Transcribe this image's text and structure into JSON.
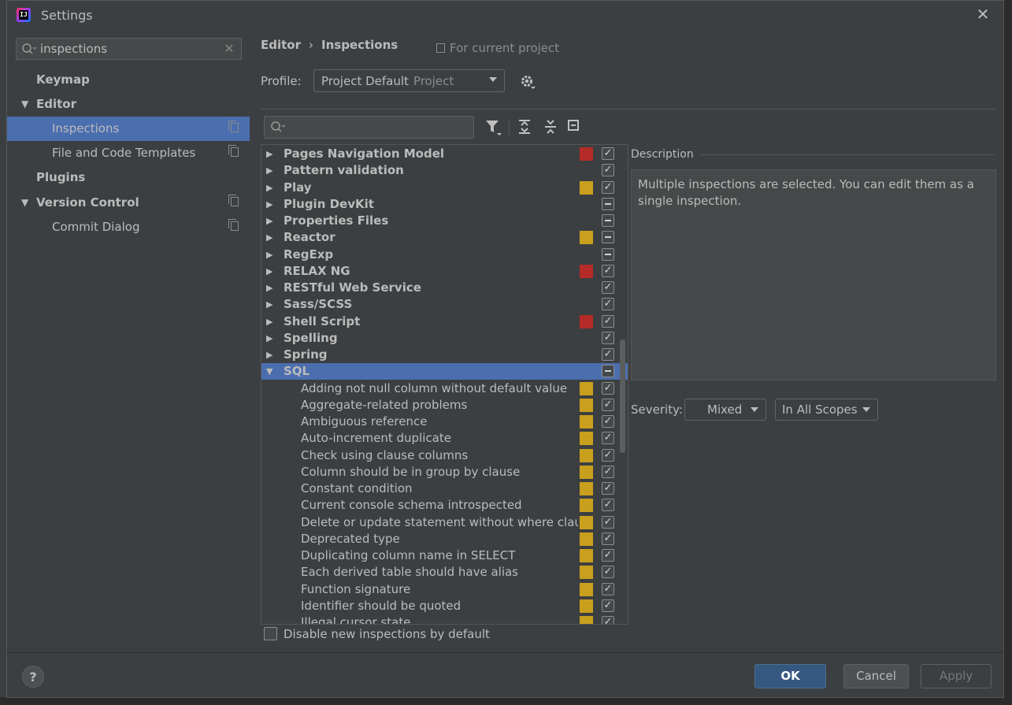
{
  "window": {
    "title": "Settings",
    "close_glyph": "✕"
  },
  "search": {
    "value": "inspections"
  },
  "nav": {
    "items": [
      {
        "label": "Keymap",
        "level": 0,
        "bold": true
      },
      {
        "label": "Editor",
        "level": 0,
        "bold": true,
        "expanded": true
      },
      {
        "label": "Inspections",
        "level": 1,
        "selected": true,
        "project_icon": true
      },
      {
        "label": "File and Code Templates",
        "level": 1,
        "project_icon": true
      },
      {
        "label": "Plugins",
        "level": 0,
        "bold": true
      },
      {
        "label": "Version Control",
        "level": 0,
        "bold": true,
        "expanded": true,
        "project_icon": true
      },
      {
        "label": "Commit Dialog",
        "level": 1,
        "project_icon": true
      }
    ]
  },
  "breadcrumb": {
    "part1": "Editor",
    "separator": "›",
    "part2": "Inspections"
  },
  "scope_note": "For current project",
  "profile": {
    "label": "Profile:",
    "value": "Project Default",
    "sub": "Project"
  },
  "colors": {
    "error": "#b52b27",
    "warning": "#c9a01e",
    "selection": "#4b6eaf"
  },
  "inspections": [
    {
      "name": "Pages Navigation Model",
      "group": true,
      "severity": "error",
      "state": "checked"
    },
    {
      "name": "Pattern validation",
      "group": true,
      "severity": "",
      "state": "checked"
    },
    {
      "name": "Play",
      "group": true,
      "severity": "warning",
      "state": "checked"
    },
    {
      "name": "Plugin DevKit",
      "group": true,
      "severity": "",
      "state": "mixed"
    },
    {
      "name": "Properties Files",
      "group": true,
      "severity": "",
      "state": "mixed"
    },
    {
      "name": "Reactor",
      "group": true,
      "severity": "warning",
      "state": "mixed"
    },
    {
      "name": "RegExp",
      "group": true,
      "severity": "",
      "state": "mixed"
    },
    {
      "name": "RELAX NG",
      "group": true,
      "severity": "error",
      "state": "checked"
    },
    {
      "name": "RESTful Web Service",
      "group": true,
      "severity": "",
      "state": "checked"
    },
    {
      "name": "Sass/SCSS",
      "group": true,
      "severity": "",
      "state": "checked"
    },
    {
      "name": "Shell Script",
      "group": true,
      "severity": "error",
      "state": "checked"
    },
    {
      "name": "Spelling",
      "group": true,
      "severity": "",
      "state": "checked"
    },
    {
      "name": "Spring",
      "group": true,
      "severity": "",
      "state": "checked"
    },
    {
      "name": "SQL",
      "group": true,
      "expanded": true,
      "selected": true,
      "severity": "",
      "state": "mixed"
    },
    {
      "name": "Adding not null column without default value",
      "group": false,
      "severity": "warning",
      "state": "checked"
    },
    {
      "name": "Aggregate-related problems",
      "group": false,
      "severity": "warning",
      "state": "checked"
    },
    {
      "name": "Ambiguous reference",
      "group": false,
      "severity": "warning",
      "state": "checked"
    },
    {
      "name": "Auto-increment duplicate",
      "group": false,
      "severity": "warning",
      "state": "checked"
    },
    {
      "name": "Check using clause columns",
      "group": false,
      "severity": "warning",
      "state": "checked"
    },
    {
      "name": "Column should be in group by clause",
      "group": false,
      "severity": "warning",
      "state": "checked"
    },
    {
      "name": "Constant condition",
      "group": false,
      "severity": "warning",
      "state": "checked"
    },
    {
      "name": "Current console schema introspected",
      "group": false,
      "severity": "warning",
      "state": "checked"
    },
    {
      "name": "Delete or update statement without where claus",
      "group": false,
      "severity": "warning",
      "state": "checked"
    },
    {
      "name": "Deprecated type",
      "group": false,
      "severity": "warning",
      "state": "checked"
    },
    {
      "name": "Duplicating column name in SELECT",
      "group": false,
      "severity": "warning",
      "state": "checked"
    },
    {
      "name": "Each derived table should have alias",
      "group": false,
      "severity": "warning",
      "state": "checked"
    },
    {
      "name": "Function signature",
      "group": false,
      "severity": "warning",
      "state": "checked"
    },
    {
      "name": "Identifier should be quoted",
      "group": false,
      "severity": "warning",
      "state": "checked"
    },
    {
      "name": "Illegal cursor state",
      "group": false,
      "severity": "warning",
      "state": "checked"
    }
  ],
  "description": {
    "label": "Description",
    "text": "Multiple inspections are selected. You can edit them as a single inspection."
  },
  "severity": {
    "label": "Severity:",
    "value": "Mixed",
    "scope": "In All Scopes"
  },
  "disable_new": {
    "label": "Disable new inspections by default",
    "checked": false
  },
  "footer": {
    "help": "?",
    "ok": "OK",
    "cancel": "Cancel",
    "apply": "Apply"
  }
}
